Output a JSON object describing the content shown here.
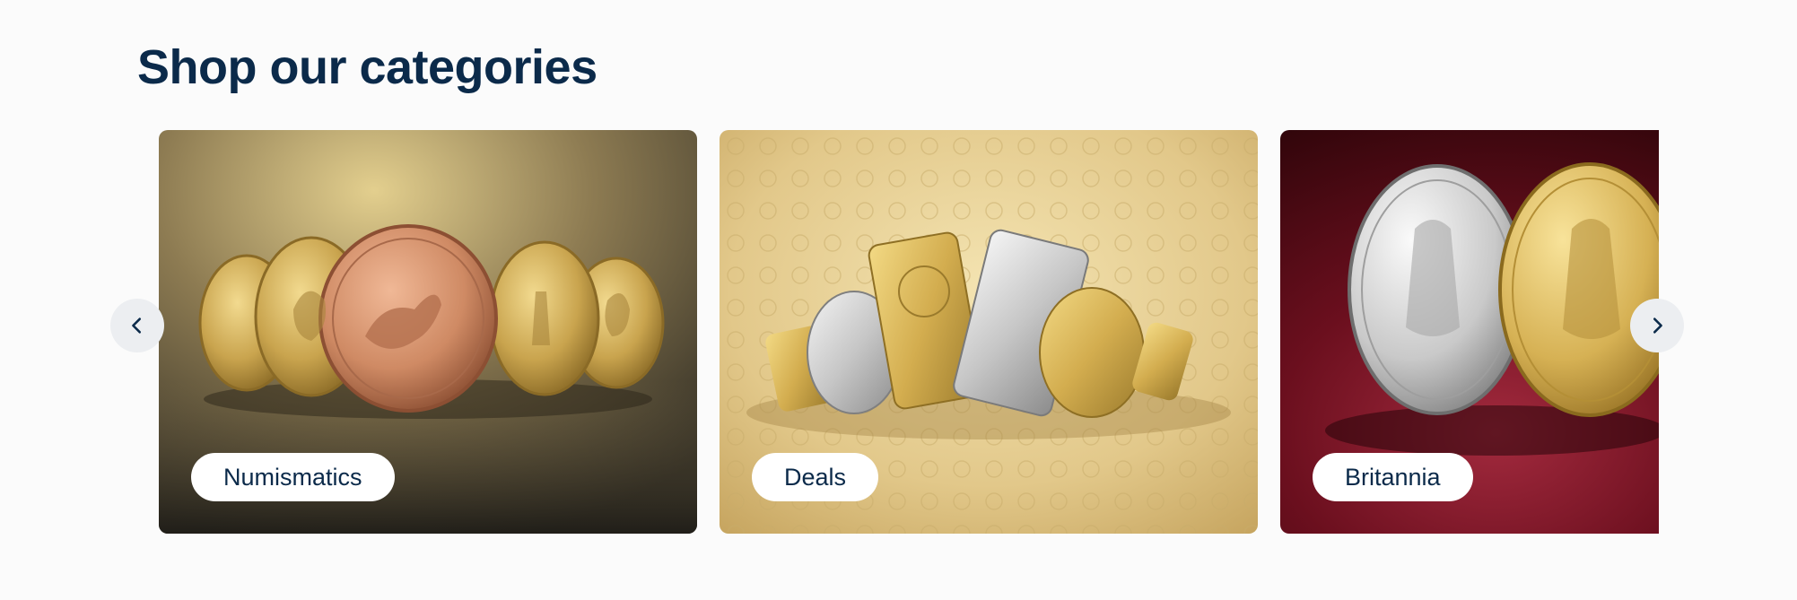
{
  "section": {
    "title": "Shop our categories"
  },
  "carousel": {
    "cards": [
      {
        "label": "Numismatics",
        "image": "gold-and-copper-historic-coins",
        "accent": "#6b5a35"
      },
      {
        "label": "Deals",
        "image": "gold-silver-bars-and-coins",
        "accent": "#d9c07c"
      },
      {
        "label": "Britannia",
        "image": "silver-and-gold-britannia-coins",
        "accent": "#5a0a16"
      }
    ],
    "prev_icon": "chevron-left-icon",
    "next_icon": "chevron-right-icon"
  },
  "colors": {
    "title": "#0b2a4a",
    "background": "#fbfbfb",
    "nav_button": "#eceef1"
  }
}
